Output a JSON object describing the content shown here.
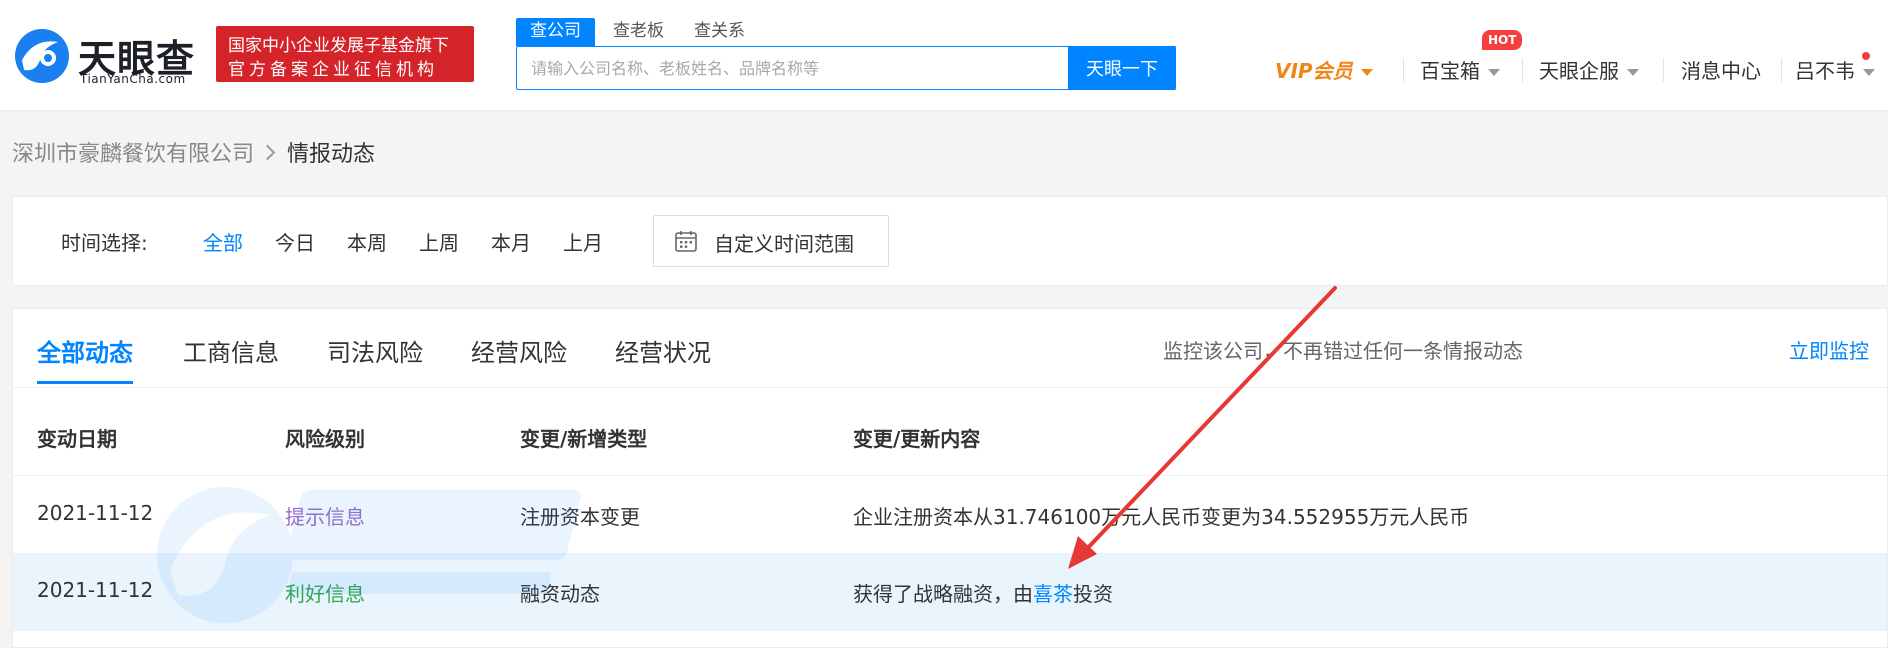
{
  "header": {
    "logo_text": "天眼查",
    "logo_sub": "TianYanCha.com",
    "badge_line1": "国家中小企业发展子基金旗下",
    "badge_line2": "官方备案企业征信机构",
    "search_tabs": [
      "查公司",
      "查老板",
      "查关系"
    ],
    "search_placeholder": "请输入公司名称、老板姓名、品牌名称等",
    "search_button": "天眼一下",
    "nav": {
      "vip": "VIP会员",
      "baibaoxiang": "百宝箱",
      "hot": "HOT",
      "qifu": "天眼企服",
      "messages": "消息中心",
      "user": "吕不韦"
    }
  },
  "breadcrumb": {
    "company": "深圳市豪麟餐饮有限公司",
    "current": "情报动态"
  },
  "filter": {
    "label": "时间选择:",
    "options": [
      "全部",
      "今日",
      "本周",
      "上周",
      "本月",
      "上月"
    ],
    "custom": "自定义时间范围"
  },
  "tabs": [
    "全部动态",
    "工商信息",
    "司法风险",
    "经营风险",
    "经营状况"
  ],
  "monitor": {
    "text": "监控该公司，不再错过任何一条情报动态",
    "link": "立即监控"
  },
  "table": {
    "headers": [
      "变动日期",
      "风险级别",
      "变更/新增类型",
      "变更/更新内容"
    ],
    "rows": [
      {
        "date": "2021-11-12",
        "level": "提示信息",
        "type": "注册资本变更",
        "content": "企业注册资本从31.746100万元人民币变更为34.552955万元人民币"
      },
      {
        "date": "2021-11-12",
        "level": "利好信息",
        "type": "融资动态",
        "content_prefix": "获得了战略融资，由",
        "content_link": "喜茶",
        "content_suffix": "投资"
      }
    ]
  },
  "colors": {
    "accent": "#0084ff",
    "badge": "#d5232a",
    "vip": "#f08519",
    "tip": "#9b6fc7",
    "good": "#32a852",
    "arrow": "#e53935"
  },
  "icons": [
    "tianyancha-logo-icon",
    "caret-down-icon",
    "chevron-right-icon",
    "calendar-icon",
    "annotation-arrow"
  ]
}
